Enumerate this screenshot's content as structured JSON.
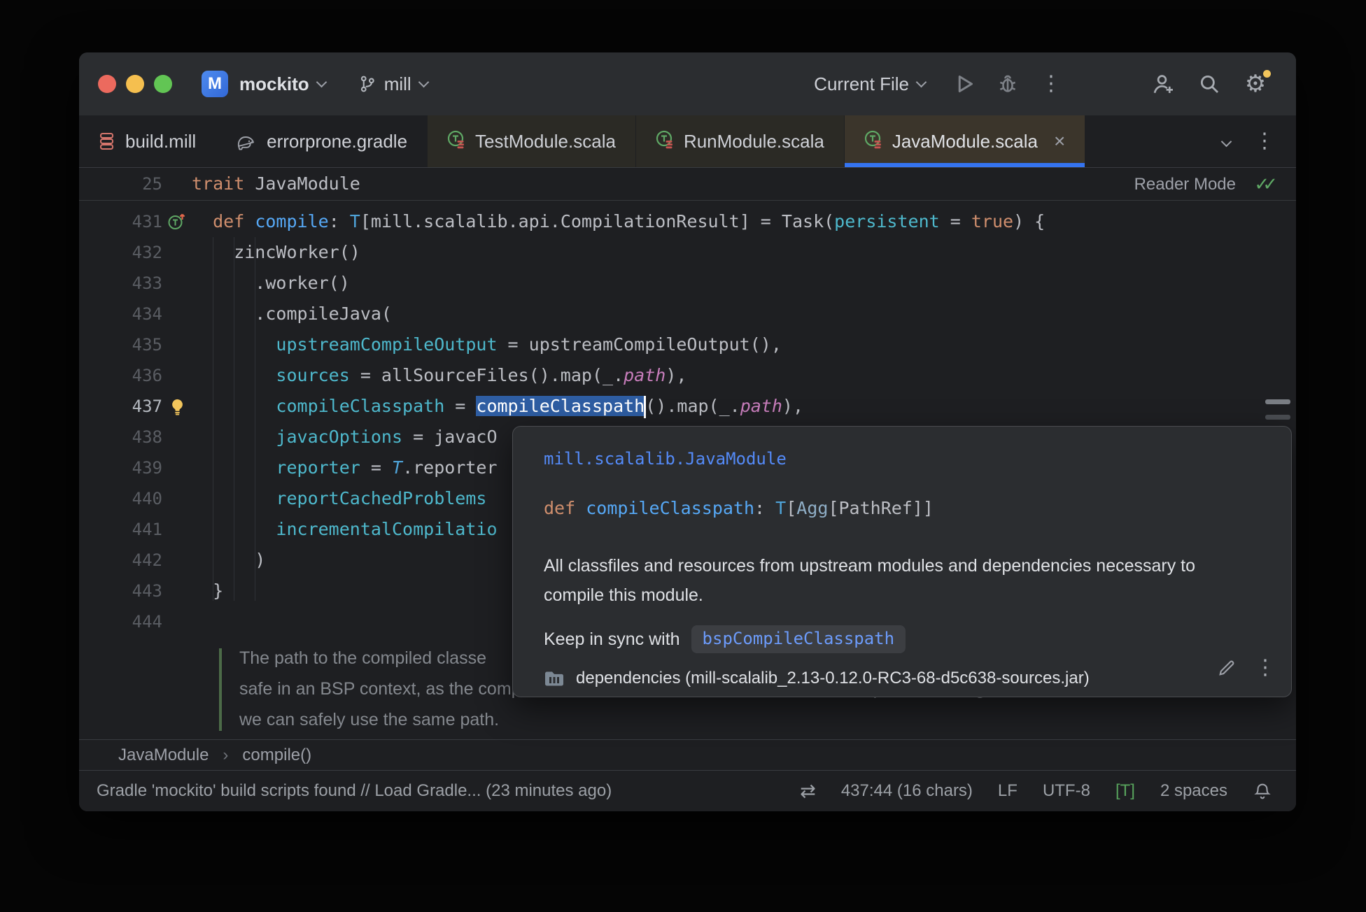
{
  "colors": {
    "accent": "#3574F0",
    "selection": "#2E5DA2",
    "editor_bg": "#1E1F22",
    "window_bg": "#2B2D30",
    "keyword": "#CF8E6D",
    "named_arg": "#4EB8CC",
    "link_blue": "#548AF7",
    "lightbulb": "#F2C55C",
    "tab_active_bg": "#3B352B"
  },
  "titlebar": {
    "project": "mockito",
    "project_initial": "M",
    "branch": "mill",
    "run_config": "Current File"
  },
  "tabs": [
    {
      "label": "build.mill"
    },
    {
      "label": "errorprone.gradle"
    },
    {
      "label": "TestModule.scala"
    },
    {
      "label": "RunModule.scala"
    },
    {
      "label": "JavaModule.scala"
    }
  ],
  "ui": {
    "close_glyph": "×",
    "more_glyph": "⋮",
    "gear_glyph": "⚙",
    "swap_glyph": "⇄",
    "dblcheck_glyph": "✓✓"
  },
  "sticky": {
    "line_no": "25",
    "tokens": [
      [
        "k",
        "trait "
      ],
      [
        "d",
        "JavaModule"
      ]
    ],
    "reader_mode": "Reader Mode"
  },
  "editor": {
    "lines": [
      {
        "num": "431",
        "gutter": "override",
        "tokens": [
          [
            "d",
            "  "
          ],
          [
            "k",
            "def "
          ],
          [
            "f",
            "compile"
          ],
          [
            "d",
            ": "
          ],
          [
            "t",
            "T"
          ],
          [
            "d",
            "[mill.scalalib.api.CompilationResult] = Task("
          ],
          [
            "a",
            "persistent"
          ],
          [
            "d",
            " = "
          ],
          [
            "k",
            "true"
          ],
          [
            "d",
            ") {"
          ]
        ]
      },
      {
        "num": "432",
        "tokens": [
          [
            "d",
            "    zincWorker()"
          ]
        ]
      },
      {
        "num": "433",
        "tokens": [
          [
            "d",
            "      .worker()"
          ]
        ]
      },
      {
        "num": "434",
        "tokens": [
          [
            "d",
            "      .compileJava("
          ]
        ]
      },
      {
        "num": "435",
        "tokens": [
          [
            "d",
            "        "
          ],
          [
            "a",
            "upstreamCompileOutput"
          ],
          [
            "d",
            " = upstreamCompileOutput(),"
          ]
        ]
      },
      {
        "num": "436",
        "tokens": [
          [
            "d",
            "        "
          ],
          [
            "a",
            "sources"
          ],
          [
            "d",
            " = allSourceFiles().map(_."
          ],
          [
            "p",
            "path"
          ],
          [
            "d",
            "),"
          ]
        ]
      },
      {
        "num": "437",
        "current": true,
        "gutter": "bulb",
        "tokens": [
          [
            "d",
            "        "
          ],
          [
            "a",
            "compileClasspath"
          ],
          [
            "d",
            " = "
          ],
          [
            "s",
            "compileClasspath"
          ],
          [
            "caret",
            ""
          ],
          [
            "d",
            "().map(_."
          ],
          [
            "p",
            "path"
          ],
          [
            "d",
            "),"
          ]
        ]
      },
      {
        "num": "438",
        "tokens": [
          [
            "d",
            "        "
          ],
          [
            "a",
            "javacOptions"
          ],
          [
            "d",
            " = javacO"
          ]
        ]
      },
      {
        "num": "439",
        "tokens": [
          [
            "d",
            "        "
          ],
          [
            "a",
            "reporter"
          ],
          [
            "d",
            " = "
          ],
          [
            "ti",
            "T"
          ],
          [
            "d",
            ".reporter"
          ]
        ]
      },
      {
        "num": "440",
        "tokens": [
          [
            "d",
            "        "
          ],
          [
            "a",
            "reportCachedProblems"
          ]
        ]
      },
      {
        "num": "441",
        "tokens": [
          [
            "d",
            "        "
          ],
          [
            "a",
            "incrementalCompilatio"
          ]
        ]
      },
      {
        "num": "442",
        "tokens": [
          [
            "d",
            "      )"
          ]
        ]
      },
      {
        "num": "443",
        "tokens": [
          [
            "d",
            "  }"
          ]
        ]
      },
      {
        "num": "444",
        "tokens": []
      }
    ],
    "comment_lines": [
      "The path to the compiled classe",
      "safe in an BSP context, as the compilation done later will use the exact same compilation settings, so",
      "we can safely use the same path."
    ]
  },
  "popup": {
    "qualifier": "mill.scalalib.JavaModule",
    "signature_tokens": [
      [
        "k",
        "def "
      ],
      [
        "f",
        "compileClasspath"
      ],
      [
        "d",
        ": "
      ],
      [
        "t",
        "T"
      ],
      [
        "d",
        "["
      ],
      [
        "ag",
        "Agg"
      ],
      [
        "d",
        "[PathRef]]"
      ]
    ],
    "description": "All classfiles and resources from upstream modules and dependencies necessary to compile this module.",
    "sync_label": "Keep in sync with",
    "sync_code": "bspCompileClasspath",
    "source": "dependencies (mill-scalalib_2.13-0.12.0-RC3-68-d5c638-sources.jar)"
  },
  "breadcrumb": {
    "item1": "JavaModule",
    "separator": "›",
    "item2": "compile()"
  },
  "statusbar": {
    "message": "Gradle 'mockito' build scripts found // Load Gradle... (23 minutes ago)",
    "position": "437:44 (16 chars)",
    "line_ending": "LF",
    "encoding": "UTF-8",
    "type_aware": "[T]",
    "indent": "2 spaces"
  }
}
